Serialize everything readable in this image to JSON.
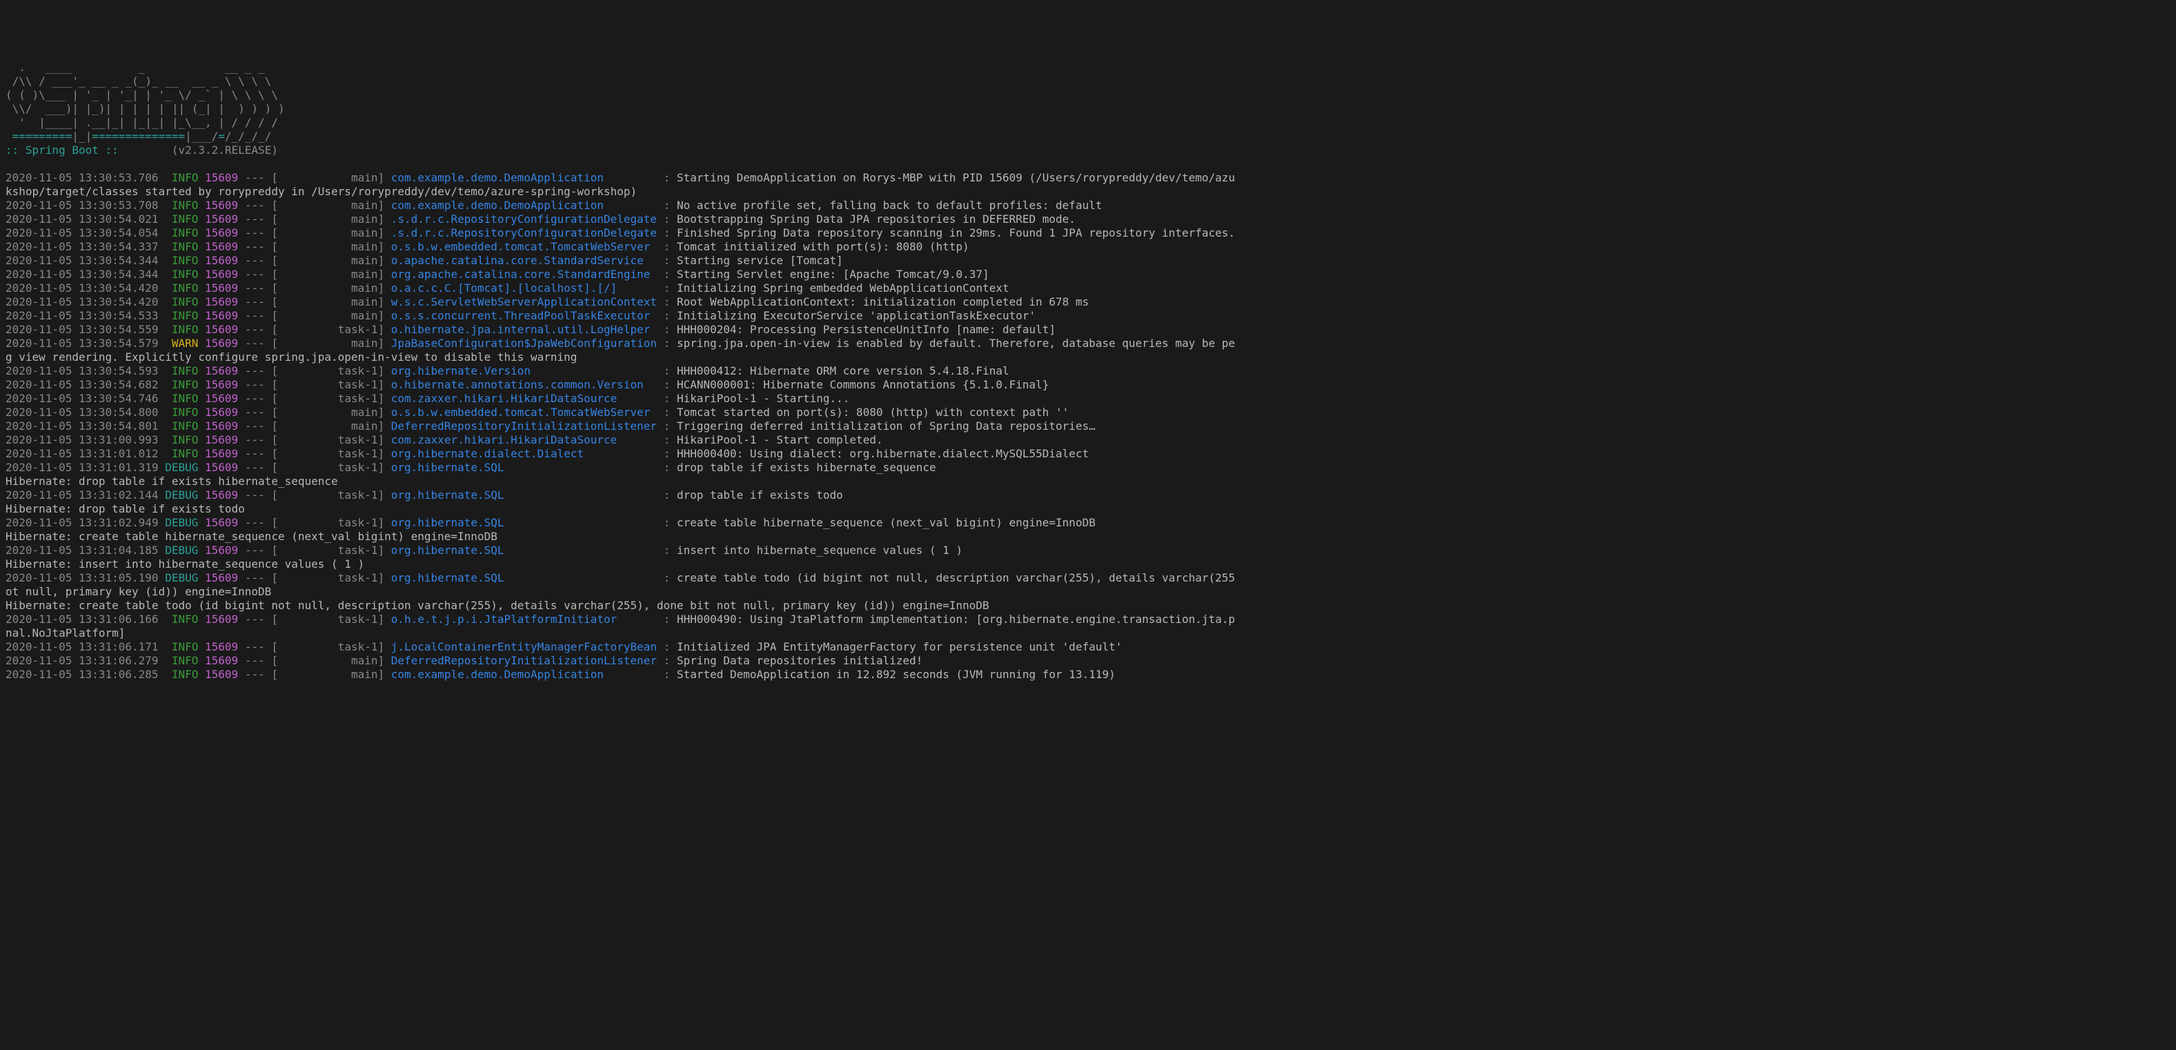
{
  "banner": {
    "title": ":: Spring Boot ::",
    "version": "(v2.3.2.RELEASE)"
  },
  "logs": [
    {
      "ts": "2020-11-05 13:30:53.706",
      "level": "INFO",
      "pid": "15609",
      "thread": "main",
      "logger": "com.example.demo.DemoApplication",
      "msg": "Starting DemoApplication on Rorys-MBP with PID 15609 (/Users/rorypreddy/dev/temo/azu"
    },
    {
      "cont": "kshop/target/classes started by rorypreddy in /Users/rorypreddy/dev/temo/azure-spring-workshop)"
    },
    {
      "ts": "2020-11-05 13:30:53.708",
      "level": "INFO",
      "pid": "15609",
      "thread": "main",
      "logger": "com.example.demo.DemoApplication",
      "msg": "No active profile set, falling back to default profiles: default"
    },
    {
      "ts": "2020-11-05 13:30:54.021",
      "level": "INFO",
      "pid": "15609",
      "thread": "main",
      "logger": ".s.d.r.c.RepositoryConfigurationDelegate",
      "msg": "Bootstrapping Spring Data JPA repositories in DEFERRED mode."
    },
    {
      "ts": "2020-11-05 13:30:54.054",
      "level": "INFO",
      "pid": "15609",
      "thread": "main",
      "logger": ".s.d.r.c.RepositoryConfigurationDelegate",
      "msg": "Finished Spring Data repository scanning in 29ms. Found 1 JPA repository interfaces."
    },
    {
      "ts": "2020-11-05 13:30:54.337",
      "level": "INFO",
      "pid": "15609",
      "thread": "main",
      "logger": "o.s.b.w.embedded.tomcat.TomcatWebServer",
      "msg": "Tomcat initialized with port(s): 8080 (http)"
    },
    {
      "ts": "2020-11-05 13:30:54.344",
      "level": "INFO",
      "pid": "15609",
      "thread": "main",
      "logger": "o.apache.catalina.core.StandardService",
      "msg": "Starting service [Tomcat]"
    },
    {
      "ts": "2020-11-05 13:30:54.344",
      "level": "INFO",
      "pid": "15609",
      "thread": "main",
      "logger": "org.apache.catalina.core.StandardEngine",
      "msg": "Starting Servlet engine: [Apache Tomcat/9.0.37]"
    },
    {
      "ts": "2020-11-05 13:30:54.420",
      "level": "INFO",
      "pid": "15609",
      "thread": "main",
      "logger": "o.a.c.c.C.[Tomcat].[localhost].[/]",
      "msg": "Initializing Spring embedded WebApplicationContext"
    },
    {
      "ts": "2020-11-05 13:30:54.420",
      "level": "INFO",
      "pid": "15609",
      "thread": "main",
      "logger": "w.s.c.ServletWebServerApplicationContext",
      "msg": "Root WebApplicationContext: initialization completed in 678 ms"
    },
    {
      "ts": "2020-11-05 13:30:54.533",
      "level": "INFO",
      "pid": "15609",
      "thread": "main",
      "logger": "o.s.s.concurrent.ThreadPoolTaskExecutor",
      "msg": "Initializing ExecutorService 'applicationTaskExecutor'"
    },
    {
      "ts": "2020-11-05 13:30:54.559",
      "level": "INFO",
      "pid": "15609",
      "thread": "task-1",
      "logger": "o.hibernate.jpa.internal.util.LogHelper",
      "msg": "HHH000204: Processing PersistenceUnitInfo [name: default]"
    },
    {
      "ts": "2020-11-05 13:30:54.579",
      "level": "WARN",
      "pid": "15609",
      "thread": "main",
      "logger": "JpaBaseConfiguration$JpaWebConfiguration",
      "msg": "spring.jpa.open-in-view is enabled by default. Therefore, database queries may be pe"
    },
    {
      "cont": "g view rendering. Explicitly configure spring.jpa.open-in-view to disable this warning"
    },
    {
      "ts": "2020-11-05 13:30:54.593",
      "level": "INFO",
      "pid": "15609",
      "thread": "task-1",
      "logger": "org.hibernate.Version",
      "msg": "HHH000412: Hibernate ORM core version 5.4.18.Final"
    },
    {
      "ts": "2020-11-05 13:30:54.682",
      "level": "INFO",
      "pid": "15609",
      "thread": "task-1",
      "logger": "o.hibernate.annotations.common.Version",
      "msg": "HCANN000001: Hibernate Commons Annotations {5.1.0.Final}"
    },
    {
      "ts": "2020-11-05 13:30:54.746",
      "level": "INFO",
      "pid": "15609",
      "thread": "task-1",
      "logger": "com.zaxxer.hikari.HikariDataSource",
      "msg": "HikariPool-1 - Starting..."
    },
    {
      "ts": "2020-11-05 13:30:54.800",
      "level": "INFO",
      "pid": "15609",
      "thread": "main",
      "logger": "o.s.b.w.embedded.tomcat.TomcatWebServer",
      "msg": "Tomcat started on port(s): 8080 (http) with context path ''"
    },
    {
      "ts": "2020-11-05 13:30:54.801",
      "level": "INFO",
      "pid": "15609",
      "thread": "main",
      "logger": "DeferredRepositoryInitializationListener",
      "msg": "Triggering deferred initialization of Spring Data repositories…"
    },
    {
      "ts": "2020-11-05 13:31:00.993",
      "level": "INFO",
      "pid": "15609",
      "thread": "task-1",
      "logger": "com.zaxxer.hikari.HikariDataSource",
      "msg": "HikariPool-1 - Start completed."
    },
    {
      "ts": "2020-11-05 13:31:01.012",
      "level": "INFO",
      "pid": "15609",
      "thread": "task-1",
      "logger": "org.hibernate.dialect.Dialect",
      "msg": "HHH000400: Using dialect: org.hibernate.dialect.MySQL55Dialect"
    },
    {
      "ts": "2020-11-05 13:31:01.319",
      "level": "DEBUG",
      "pid": "15609",
      "thread": "task-1",
      "logger": "org.hibernate.SQL",
      "msg": "drop table if exists hibernate_sequence"
    },
    {
      "cont": "Hibernate: drop table if exists hibernate_sequence"
    },
    {
      "ts": "2020-11-05 13:31:02.144",
      "level": "DEBUG",
      "pid": "15609",
      "thread": "task-1",
      "logger": "org.hibernate.SQL",
      "msg": "drop table if exists todo"
    },
    {
      "cont": "Hibernate: drop table if exists todo"
    },
    {
      "ts": "2020-11-05 13:31:02.949",
      "level": "DEBUG",
      "pid": "15609",
      "thread": "task-1",
      "logger": "org.hibernate.SQL",
      "msg": "create table hibernate_sequence (next_val bigint) engine=InnoDB"
    },
    {
      "cont": "Hibernate: create table hibernate_sequence (next_val bigint) engine=InnoDB"
    },
    {
      "ts": "2020-11-05 13:31:04.185",
      "level": "DEBUG",
      "pid": "15609",
      "thread": "task-1",
      "logger": "org.hibernate.SQL",
      "msg": "insert into hibernate_sequence values ( 1 )"
    },
    {
      "cont": "Hibernate: insert into hibernate_sequence values ( 1 )"
    },
    {
      "ts": "2020-11-05 13:31:05.190",
      "level": "DEBUG",
      "pid": "15609",
      "thread": "task-1",
      "logger": "org.hibernate.SQL",
      "msg": "create table todo (id bigint not null, description varchar(255), details varchar(255"
    },
    {
      "cont": "ot null, primary key (id)) engine=InnoDB"
    },
    {
      "cont": "Hibernate: create table todo (id bigint not null, description varchar(255), details varchar(255), done bit not null, primary key (id)) engine=InnoDB"
    },
    {
      "ts": "2020-11-05 13:31:06.166",
      "level": "INFO",
      "pid": "15609",
      "thread": "task-1",
      "logger": "o.h.e.t.j.p.i.JtaPlatformInitiator",
      "msg": "HHH000490: Using JtaPlatform implementation: [org.hibernate.engine.transaction.jta.p"
    },
    {
      "cont": "nal.NoJtaPlatform]"
    },
    {
      "ts": "2020-11-05 13:31:06.171",
      "level": "INFO",
      "pid": "15609",
      "thread": "task-1",
      "logger": "j.LocalContainerEntityManagerFactoryBean",
      "msg": "Initialized JPA EntityManagerFactory for persistence unit 'default'"
    },
    {
      "ts": "2020-11-05 13:31:06.279",
      "level": "INFO",
      "pid": "15609",
      "thread": "main",
      "logger": "DeferredRepositoryInitializationListener",
      "msg": "Spring Data repositories initialized!"
    },
    {
      "ts": "2020-11-05 13:31:06.285",
      "level": "INFO",
      "pid": "15609",
      "thread": "main",
      "logger": "com.example.demo.DemoApplication",
      "msg": "Started DemoApplication in 12.892 seconds (JVM running for 13.119)"
    }
  ]
}
